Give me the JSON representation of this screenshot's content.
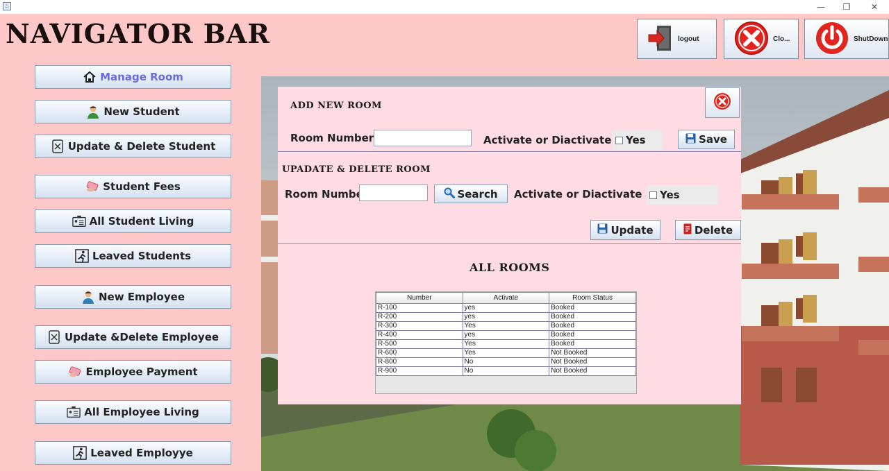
{
  "window": {
    "title_icon": "java-icon",
    "min": "—",
    "max": "❐",
    "close": "✕"
  },
  "header": {
    "title": "NAVIGATOR BAR",
    "buttons": [
      {
        "label": "logout",
        "icon": "logout-door-icon"
      },
      {
        "label": "Clo...",
        "icon": "close-circle-icon"
      },
      {
        "label": "ShutDown",
        "icon": "power-icon"
      }
    ]
  },
  "sidebar": {
    "items": [
      {
        "label": "Manage Room",
        "icon": "home-icon",
        "active": true
      },
      {
        "label": "New Student",
        "icon": "user-icon"
      },
      {
        "label": "Update & Delete Student",
        "icon": "edit-delete-icon"
      },
      {
        "label": "Student Fees",
        "icon": "money-icon"
      },
      {
        "label": "All Student Living",
        "icon": "id-card-icon"
      },
      {
        "label": "Leaved Students",
        "icon": "exit-icon"
      },
      {
        "label": "New Employee",
        "icon": "user-icon"
      },
      {
        "label": "Update &Delete Employee",
        "icon": "edit-delete-icon"
      },
      {
        "label": "Employee Payment",
        "icon": "money-icon"
      },
      {
        "label": "All Employee Living",
        "icon": "id-card-icon"
      },
      {
        "label": "Leaved Employye",
        "icon": "exit-icon"
      }
    ]
  },
  "add_room": {
    "title": "ADD NEW ROOM",
    "room_label": "Room Number",
    "room_value": "",
    "activate_label": "Activate or Diactivate",
    "check_label": "Yes",
    "save_label": "Save"
  },
  "update_room": {
    "title": "UPADATE & DELETE ROOM",
    "room_label": "Room Number",
    "room_value": "",
    "search_label": "Search",
    "activate_label": "Activate or Diactivate",
    "check_label": "Yes",
    "update_label": "Update",
    "delete_label": "Delete"
  },
  "rooms": {
    "title": "ALL ROOMS",
    "columns": [
      "Number",
      "Activate",
      "Room Status"
    ],
    "rows": [
      [
        "R-100",
        "yes",
        "Booked"
      ],
      [
        "R-200",
        "yes",
        "Booked"
      ],
      [
        "R-300",
        "Yes",
        "Booked"
      ],
      [
        "R-400",
        "yes",
        "Booked"
      ],
      [
        "R-500",
        "Yes",
        "Booked"
      ],
      [
        "R-600",
        "Yes",
        "Not Booked"
      ],
      [
        "R-800",
        "No",
        "Not Booked"
      ],
      [
        "R-900",
        "No",
        "Not Booked"
      ]
    ]
  },
  "colors": {
    "background": "#ffc8c8",
    "panel": "#ffdce4",
    "active_text": "#6b6be0"
  }
}
